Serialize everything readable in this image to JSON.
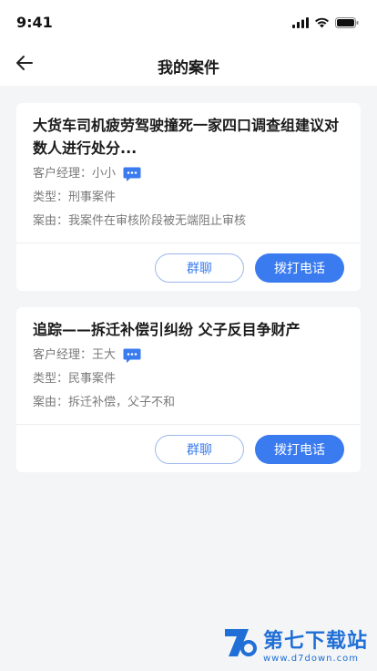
{
  "status": {
    "time": "9:41"
  },
  "nav": {
    "title": "我的案件"
  },
  "cases": [
    {
      "title": "大货车司机疲劳驾驶撞死一家四口调查组建议对数人进行处分...",
      "manager_label": "客户经理：",
      "manager": "小小",
      "type_label": "类型：",
      "type": "刑事案件",
      "reason_label": "案由：",
      "reason": "我案件在审核阶段被无端阻止审核",
      "group_chat": "群聊",
      "call": "拨打电话"
    },
    {
      "title": "追踪——拆迁补偿引纠纷 父子反目争财产",
      "manager_label": "客户经理：",
      "manager": "王大",
      "type_label": "类型：",
      "type": "民事案件",
      "reason_label": "案由：",
      "reason": "拆迁补偿，父子不和",
      "group_chat": "群聊",
      "call": "拨打电话"
    }
  ],
  "watermark": {
    "brand": "第七下载站",
    "url": "www.d7down.com"
  },
  "colors": {
    "primary": "#3a7bf0",
    "background": "#f4f5f7",
    "chat_icon": "#3a7bf0"
  },
  "icons": [
    "signal-icon",
    "wifi-icon",
    "battery-icon",
    "back-arrow-icon",
    "chat-bubble-icon"
  ]
}
